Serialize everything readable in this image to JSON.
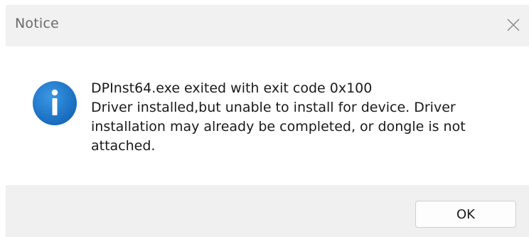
{
  "dialog": {
    "title": "Notice",
    "icon": "info-icon",
    "message_lines": [
      "DPInst64.exe exited with exit code 0x100",
      "Driver installed,but unable to install for device. Driver",
      "installation may already be completed, or dongle is not",
      "attached."
    ],
    "ok_label": "OK",
    "close_icon": "close-icon"
  },
  "colors": {
    "titlebar_bg": "#f1f1f1",
    "footer_bg": "#f0f0f0",
    "icon_blue": "#1a73c8",
    "text": "#1a1a1a"
  }
}
